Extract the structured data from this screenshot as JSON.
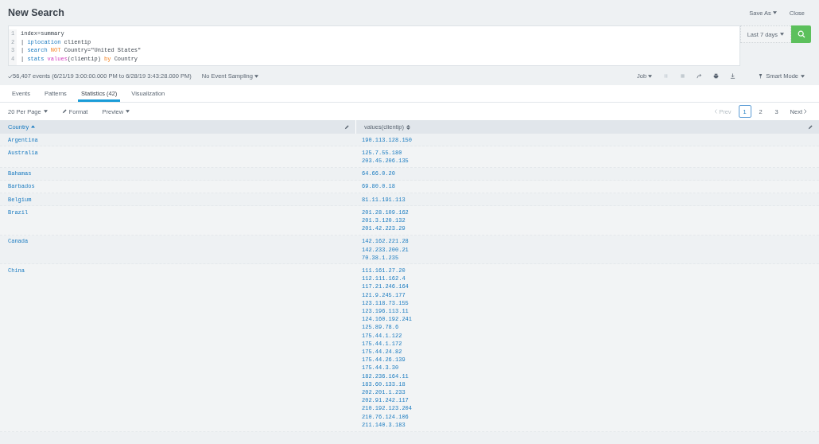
{
  "header": {
    "title": "New Search",
    "actions": [
      {
        "label": "Save As",
        "dropdown": true
      },
      {
        "label": "Close",
        "dropdown": false
      }
    ]
  },
  "search": {
    "lines": [
      {
        "number": "1",
        "tokens": [
          {
            "text": "index=summary",
            "kind": "plain"
          }
        ]
      },
      {
        "number": "2",
        "tokens": [
          {
            "text": "| ",
            "kind": "plain"
          },
          {
            "text": "iplocation",
            "kind": "command"
          },
          {
            "text": " clientip",
            "kind": "plain"
          }
        ]
      },
      {
        "number": "3",
        "tokens": [
          {
            "text": "| ",
            "kind": "plain"
          },
          {
            "text": "search",
            "kind": "command"
          },
          {
            "text": " NOT",
            "kind": "keyword"
          },
          {
            "text": " Country=\"United States\"",
            "kind": "plain"
          }
        ]
      },
      {
        "number": "4",
        "tokens": [
          {
            "text": "| ",
            "kind": "plain"
          },
          {
            "text": "stats",
            "kind": "command"
          },
          {
            "text": " values",
            "kind": "function"
          },
          {
            "text": "(clientip) ",
            "kind": "plain"
          },
          {
            "text": "by",
            "kind": "keyword"
          },
          {
            "text": " Country",
            "kind": "plain"
          }
        ]
      }
    ],
    "time_range": "Last 7 days"
  },
  "status": {
    "summary": "56,407 events (6/21/19 3:00:00.000 PM to 6/28/19 3:43:28.000 PM)",
    "sampling": "No Event Sampling",
    "job": "Job",
    "mode": "Smart Mode"
  },
  "tabs": [
    {
      "label": "Events",
      "selected": false
    },
    {
      "label": "Patterns",
      "selected": false
    },
    {
      "label": "Statistics (42)",
      "selected": true
    },
    {
      "label": "Visualization",
      "selected": false
    }
  ],
  "toolbar": {
    "per_page": "20 Per Page",
    "format": "Format",
    "preview": "Preview"
  },
  "pagination": {
    "prev": {
      "label": "Prev",
      "disabled": true
    },
    "pages": [
      {
        "label": "1",
        "selected": true
      },
      {
        "label": "2",
        "selected": false
      },
      {
        "label": "3",
        "selected": false
      }
    ],
    "next": {
      "label": "Next",
      "disabled": false
    }
  },
  "table": {
    "columns": [
      {
        "label": "Country",
        "sorted": true
      },
      {
        "label": "values(clientip)",
        "sorted": false
      }
    ],
    "rows": [
      {
        "country": "Argentina",
        "values": [
          "190.113.128.150"
        ]
      },
      {
        "country": "Australia",
        "values": [
          "125.7.55.180",
          "203.45.206.135"
        ]
      },
      {
        "country": "Bahamas",
        "values": [
          "64.66.0.20"
        ]
      },
      {
        "country": "Barbados",
        "values": [
          "69.80.0.18"
        ]
      },
      {
        "country": "Belgium",
        "values": [
          "81.11.191.113"
        ]
      },
      {
        "country": "Brazil",
        "values": [
          "201.28.109.162",
          "201.3.120.132",
          "201.42.223.29"
        ]
      },
      {
        "country": "Canada",
        "values": [
          "142.162.221.28",
          "142.233.200.21",
          "70.38.1.235"
        ]
      },
      {
        "country": "China",
        "values": [
          "111.161.27.20",
          "112.111.162.4",
          "117.21.246.164",
          "121.9.245.177",
          "123.118.73.155",
          "123.196.113.11",
          "124.160.192.241",
          "125.89.78.6",
          "175.44.1.122",
          "175.44.1.172",
          "175.44.24.82",
          "175.44.26.139",
          "175.44.3.30",
          "182.236.164.11",
          "183.60.133.18",
          "202.201.1.233",
          "202.91.242.117",
          "210.192.123.204",
          "210.76.124.106",
          "211.140.3.183"
        ]
      }
    ]
  }
}
